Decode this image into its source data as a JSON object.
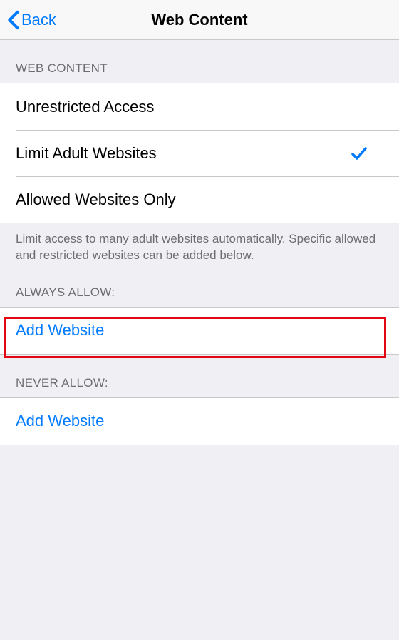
{
  "header": {
    "back_label": "Back",
    "title": "Web Content"
  },
  "sections": {
    "web_content": {
      "header": "WEB CONTENT",
      "options": [
        {
          "label": "Unrestricted Access",
          "selected": false
        },
        {
          "label": "Limit Adult Websites",
          "selected": true
        },
        {
          "label": "Allowed Websites Only",
          "selected": false
        }
      ],
      "footer": "Limit access to many adult websites automatically. Specific allowed and restricted websites can be added below."
    },
    "always_allow": {
      "header": "ALWAYS ALLOW:",
      "add_label": "Add Website"
    },
    "never_allow": {
      "header": "NEVER ALLOW:",
      "add_label": "Add Website"
    }
  }
}
